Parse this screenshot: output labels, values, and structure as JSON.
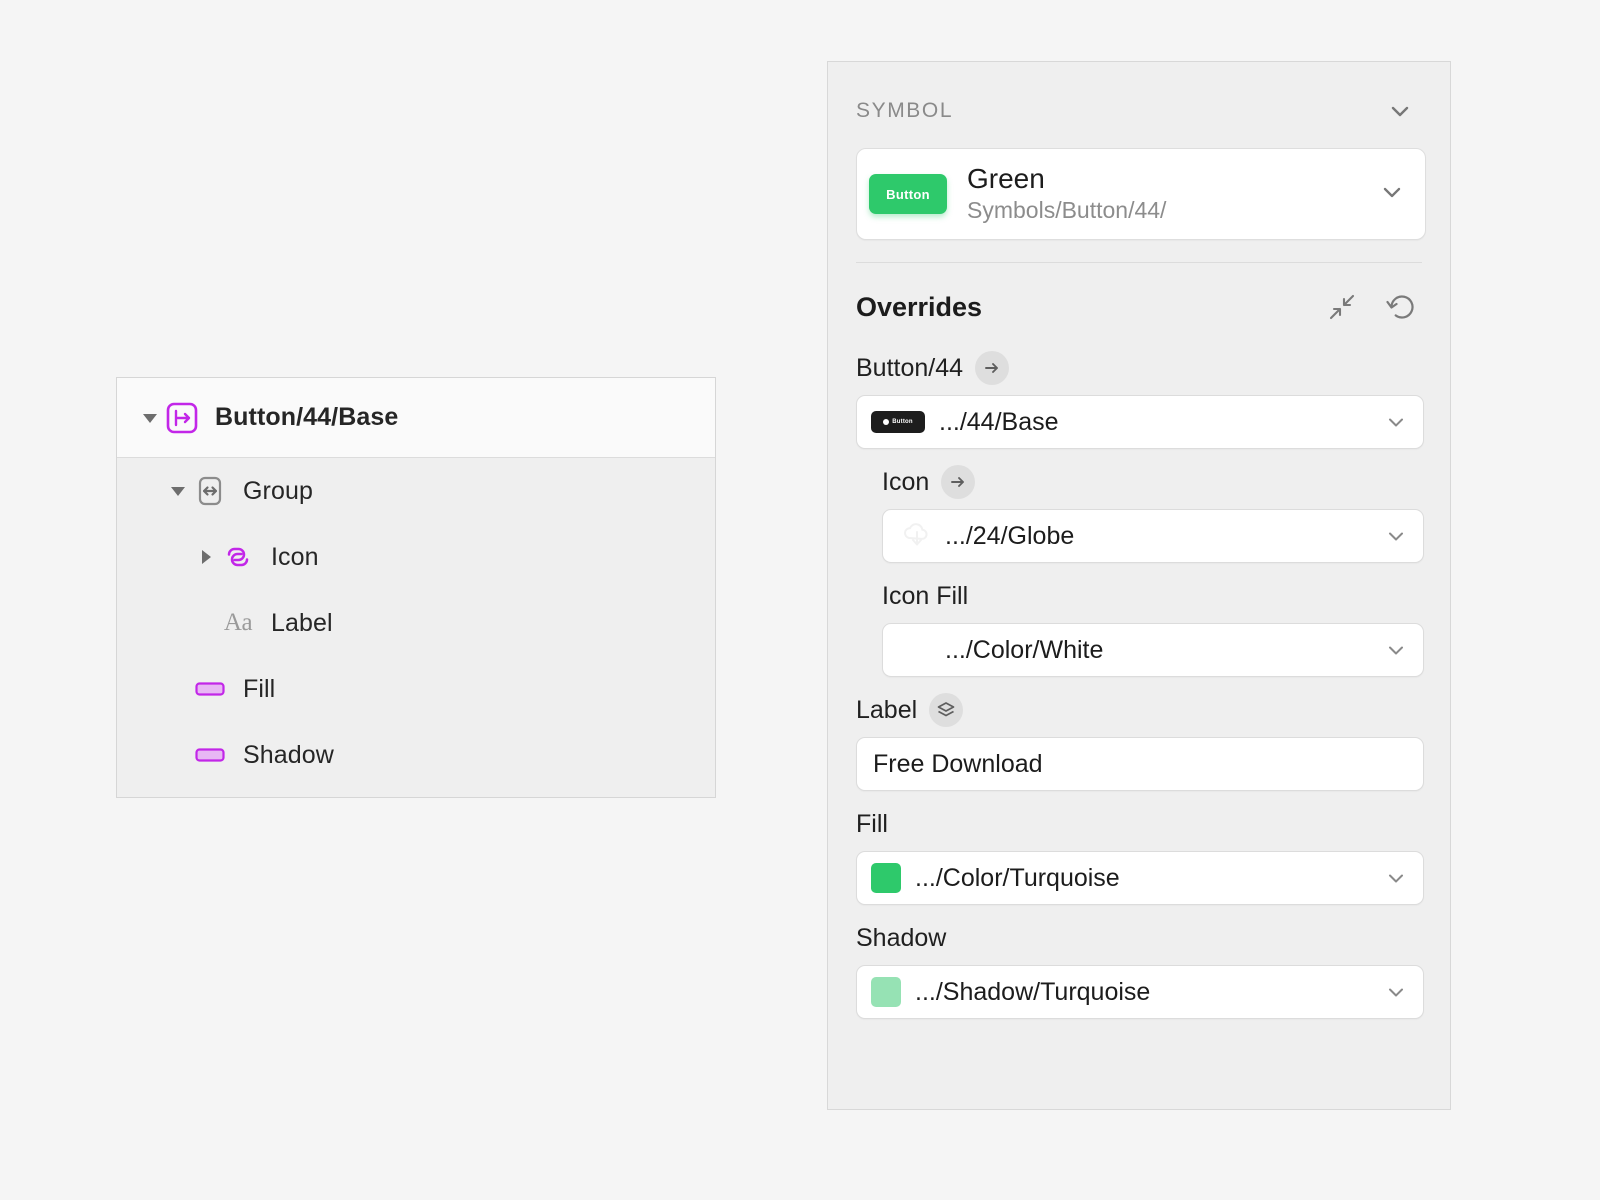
{
  "colors": {
    "turquoise": "#2ec96b",
    "shadow_turquoise": "#96e2b4",
    "symbol_purple": "#c226e8",
    "panel_bg": "#efefef",
    "accent_text": "#1c1c1c"
  },
  "layer_tree": {
    "rows": [
      {
        "label": "Button/44/Base",
        "icon": "symbol-instance-icon",
        "disclosure": "expanded",
        "depth": 1,
        "selected": true,
        "bold": true
      },
      {
        "label": "Group",
        "icon": "group-resize-icon",
        "disclosure": "expanded",
        "depth": 2,
        "selected": false,
        "bold": false
      },
      {
        "label": "Icon",
        "icon": "nested-symbol-icon",
        "disclosure": "collapsed",
        "depth": 3,
        "selected": false,
        "bold": false
      },
      {
        "label": "Label",
        "icon": "text-layer-icon",
        "disclosure": "none",
        "depth": 3,
        "selected": false,
        "bold": false
      },
      {
        "label": "Fill",
        "icon": "shape-rect-icon",
        "disclosure": "none",
        "depth": 2,
        "selected": false,
        "bold": false
      },
      {
        "label": "Shadow",
        "icon": "shape-rect-icon",
        "disclosure": "none",
        "depth": 2,
        "selected": false,
        "bold": false
      }
    ]
  },
  "inspector": {
    "symbol_section": {
      "title": "SYMBOL",
      "collapse_icon": "chevron-down-icon",
      "master": {
        "name": "Green",
        "path": "Symbols/Button/44/",
        "thumbnail_label": "Button",
        "thumbnail_color": "#2ec96b",
        "dropdown_icon": "chevron-down-icon"
      }
    },
    "overrides_section": {
      "title": "Overrides",
      "collapse_all_icon": "collapse-arrows-icon",
      "reset_icon": "reset-arrow-icon",
      "fields": [
        {
          "label": "Button/44",
          "badge": "arrow-right-icon",
          "nested": false,
          "control": "select",
          "value": ".../44/Base",
          "preview": "dark-button-thumb",
          "preview_label": "Button",
          "chevron": "chevron-down-icon"
        },
        {
          "label": "Icon",
          "badge": "arrow-right-icon",
          "nested": true,
          "control": "select",
          "value": ".../24/Globe",
          "preview": "globe-glyph",
          "chevron": "chevron-down-icon"
        },
        {
          "label": "Icon Fill",
          "badge": null,
          "nested": true,
          "control": "select",
          "value": ".../Color/White",
          "preview": "none",
          "chevron": "chevron-down-icon"
        },
        {
          "label": "Label",
          "badge": "layers-icon",
          "nested": false,
          "control": "text",
          "value": "Free Download",
          "placeholder": "Label"
        },
        {
          "label": "Fill",
          "badge": null,
          "nested": false,
          "control": "select",
          "value": ".../Color/Turquoise",
          "preview": "swatch",
          "swatch_color": "#2ec96b",
          "chevron": "chevron-down-icon"
        },
        {
          "label": "Shadow",
          "badge": null,
          "nested": false,
          "control": "select",
          "value": ".../Shadow/Turquoise",
          "preview": "swatch",
          "swatch_color": "#96e2b4",
          "chevron": "chevron-down-icon"
        }
      ]
    }
  }
}
